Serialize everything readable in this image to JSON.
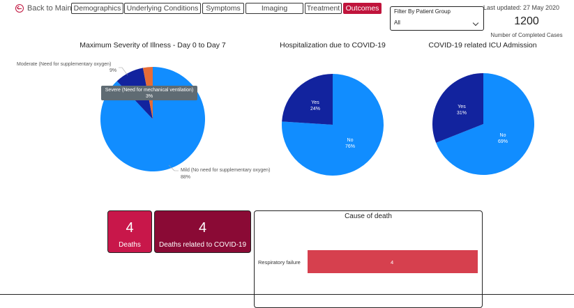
{
  "nav": {
    "back_label": "Back to Main",
    "tabs": [
      {
        "label": "Demographics",
        "active": false
      },
      {
        "label": "Underlying Conditions",
        "active": false
      },
      {
        "label": "Symptoms",
        "active": false
      },
      {
        "label": "Imaging",
        "active": false
      },
      {
        "label": "Treatment",
        "active": false
      },
      {
        "label": "Outcomes",
        "active": true
      }
    ]
  },
  "filter": {
    "label": "Filter By Patient Group",
    "value": "All"
  },
  "header": {
    "last_updated": "Last updated: 27 May 2020",
    "completed_cases": "1200",
    "completed_cases_label": "Number of Completed Cases"
  },
  "tooltip": {
    "line1": "Severe (Need for mechanical ventilation)",
    "line2": "3%"
  },
  "cards": {
    "deaths": {
      "value": "4",
      "label": "Deaths"
    },
    "covid_deaths": {
      "value": "4",
      "label": "Deaths related to COVID-19"
    }
  },
  "colors": {
    "accent": "#c0143c",
    "pie_main": "#118dff",
    "pie_dark": "#12239e",
    "pie_orange": "#e66c37",
    "bar": "#d6404e",
    "dark_card": "#8a0a35",
    "light_card": "#c8174a"
  },
  "chart_data": [
    {
      "type": "pie",
      "title": "Maximum Severity of Illness - Day 0 to Day 7",
      "categories": [
        "Mild (No need for supplementary oxygen)",
        "Moderate (Need for supplementary oxygen)",
        "Severe (Need for mechanical ventilation)"
      ],
      "values": [
        88,
        9,
        3
      ],
      "value_labels": [
        "88%",
        "9%",
        "3%"
      ]
    },
    {
      "type": "pie",
      "title": "Hospitalization due to COVID-19",
      "categories": [
        "No",
        "Yes"
      ],
      "values": [
        76,
        24
      ],
      "value_labels": [
        "76%",
        "24%"
      ]
    },
    {
      "type": "pie",
      "title": "COVID-19 related ICU Admission",
      "categories": [
        "No",
        "Yes"
      ],
      "values": [
        69,
        31
      ],
      "value_labels": [
        "69%",
        "31%"
      ]
    },
    {
      "type": "bar",
      "title": "Cause of death",
      "categories": [
        "Respiratory failure"
      ],
      "values": [
        4
      ]
    }
  ]
}
